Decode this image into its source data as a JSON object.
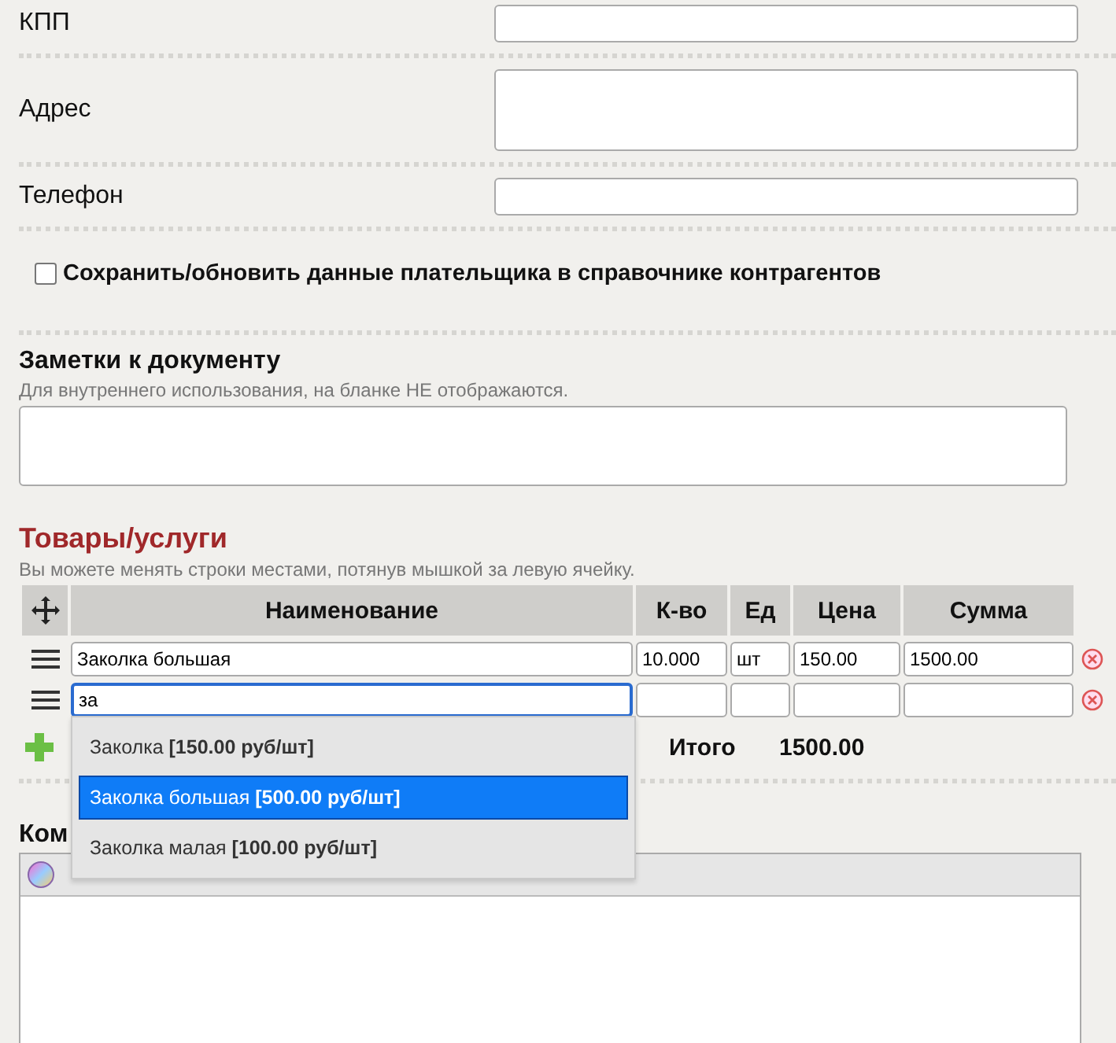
{
  "fields": [
    {
      "label": "КПП",
      "kind": "input"
    },
    {
      "label": "Адрес",
      "kind": "textarea"
    },
    {
      "label": "Телефон",
      "kind": "input"
    }
  ],
  "save_checkbox": {
    "label": "Сохранить/обновить данные плательщика в справочнике контрагентов",
    "checked": false
  },
  "notes": {
    "title": "Заметки к документу",
    "hint": "Для внутреннего использования, на бланке НЕ отображаются."
  },
  "goods": {
    "title": "Товары/услуги",
    "hint": "Вы можете менять строки местами, потянув мышкой за левую ячейку.",
    "columns": [
      "Наименование",
      "К-во",
      "Ед",
      "Цена",
      "Сумма"
    ],
    "rows": [
      {
        "name": "Заколка большая",
        "qty": "10.000",
        "unit": "шт",
        "price": "150.00",
        "sum": "1500.00",
        "focused": false
      },
      {
        "name": "за",
        "qty": "",
        "unit": "",
        "price": "",
        "sum": "",
        "focused": true
      }
    ],
    "total_label": "Итого",
    "total": "1500.00"
  },
  "autocomplete": {
    "items": [
      {
        "text": "Заколка **[150.00 руб/шт]**",
        "selected": false
      },
      {
        "text": "Заколка большая **[500.00 руб/шт]**",
        "selected": true
      },
      {
        "text": "Заколка малая **[100.00 руб/шт]**",
        "selected": false
      }
    ]
  },
  "comments": {
    "title": "Ком"
  }
}
